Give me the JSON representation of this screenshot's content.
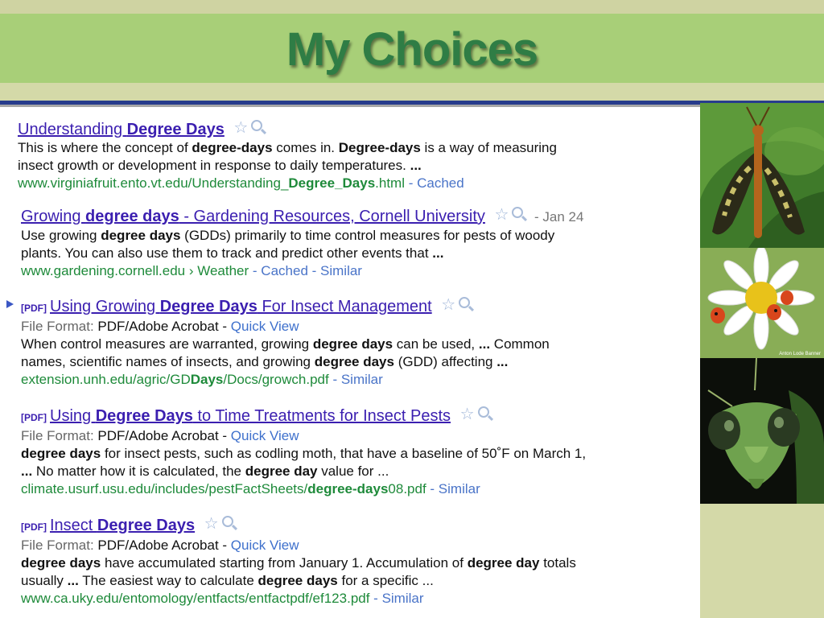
{
  "slide": {
    "title": "My Choices"
  },
  "results": [
    {
      "title_parts": [
        "Understanding ",
        "Degree Days"
      ],
      "snippet": [
        [
          "This is where the concept of ",
          "degree-days",
          " comes in. ",
          "Degree-days",
          " is a way of measuring"
        ],
        [
          "insect growth or development in response to daily temperatures. ",
          "...",
          "",
          "",
          ""
        ]
      ],
      "url_parts": [
        "www.virginiafruit.ento.vt.edu/Understanding_",
        "Degree_Days",
        ".html"
      ],
      "links": [
        " - ",
        "Cached"
      ]
    },
    {
      "title_parts": [
        "Growing ",
        "degree days",
        " - Gardening Resources, Cornell University"
      ],
      "date": "- Jan 24",
      "snippet": [
        [
          "Use growing ",
          "degree days",
          " (GDDs) primarily to time control measures for pests of woody",
          "",
          ""
        ],
        [
          "plants. You can also use them to track and predict other events that ",
          "...",
          "",
          "",
          ""
        ]
      ],
      "url_parts": [
        "www.gardening.cornell.edu › Weather",
        "",
        ""
      ],
      "links": [
        " - ",
        "Cached",
        " - ",
        "Similar"
      ]
    },
    {
      "pdf": "[PDF]",
      "title_parts": [
        "Using Growing ",
        "Degree Days",
        " For Insect Management"
      ],
      "format_label": "File Format:",
      "format_value": " PDF/Adobe Acrobat - ",
      "quick_view": "Quick View",
      "snippet": [
        [
          "When control measures are warranted, growing ",
          "degree days",
          " can be used, ",
          "...",
          " Common"
        ],
        [
          "names, scientific names of insects, and growing ",
          "degree days",
          " (GDD) affecting ",
          "...",
          ""
        ]
      ],
      "url_parts": [
        "extension.unh.edu/agric/GD",
        "Days",
        "/Docs/growch.pdf"
      ],
      "links": [
        " - ",
        "Similar"
      ]
    },
    {
      "pdf": "[PDF]",
      "title_parts": [
        "Using ",
        "Degree Days",
        " to Time Treatments for Insect Pests"
      ],
      "format_label": "File Format:",
      "format_value": " PDF/Adobe Acrobat - ",
      "quick_view": "Quick View",
      "snippet": [
        [
          "",
          "degree days",
          " for insect pests, such as codling moth, that have a baseline of 50˚F on March 1,",
          "",
          ""
        ],
        [
          "",
          "...",
          " No matter how it is calculated, the ",
          "degree day",
          " value for ..."
        ]
      ],
      "url_parts": [
        "climate.usurf.usu.edu/includes/pestFactSheets/",
        "degree-days",
        "08.pdf"
      ],
      "links": [
        " - ",
        "Similar"
      ]
    },
    {
      "pdf": "[PDF]",
      "title_parts": [
        "Insect ",
        "Degree Days",
        ""
      ],
      "format_label": "File Format:",
      "format_value": " PDF/Adobe Acrobat - ",
      "quick_view": "Quick View",
      "snippet": [
        [
          "",
          "degree days",
          " have accumulated starting from January 1. Accumulation of ",
          "degree day",
          " totals"
        ],
        [
          "usually ",
          "...",
          " The easiest way to calculate ",
          "degree days",
          " for a specific ..."
        ]
      ],
      "url_parts": [
        "www.ca.uky.edu/entomology/entfacts/entfactpdf/ef123.pdf",
        "",
        ""
      ],
      "links": [
        " - ",
        "Similar"
      ]
    }
  ],
  "icons": {
    "star": "star-outline-icon",
    "search": "magnifier-icon",
    "arrow": "triangle-right-icon"
  },
  "photos": [
    "scorpionfly-photo",
    "daisy-ladybugs-photo",
    "praying-mantis-photo"
  ],
  "photo_credit": "Anton Lode Banner",
  "colors": {
    "title": "#2f7d45",
    "title_bar": "#a8cf78",
    "rule": "#273c8c",
    "link": "#3b1fb0",
    "url": "#1e8a3a"
  }
}
